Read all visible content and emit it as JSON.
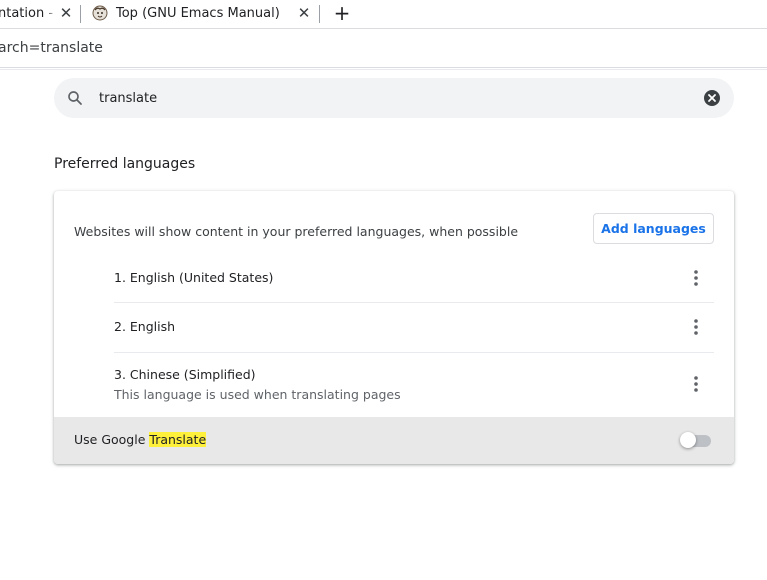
{
  "tabs": [
    {
      "title": "ntation - ",
      "active": false
    },
    {
      "title": "Top (GNU Emacs Manual)",
      "active": false
    }
  ],
  "new_tab_label": "+",
  "address_bar": {
    "url_text": "arch=translate"
  },
  "search": {
    "value": "translate"
  },
  "preferred_languages": {
    "title": "Preferred languages",
    "description": "Websites will show content in your preferred languages, when possible",
    "add_button_label": "Add languages",
    "languages": [
      {
        "name": "1. English (United States)"
      },
      {
        "name": "2. English"
      },
      {
        "name": "3. Chinese (Simplified)",
        "note": "This language is used when translating pages"
      }
    ]
  },
  "google_translate": {
    "label_prefix": "Use Google ",
    "label_highlight": "Translate",
    "enabled": false
  },
  "colors": {
    "accent": "#1a73e8",
    "highlight": "#fff03c",
    "search_bg": "#f1f3f4"
  },
  "icons": {
    "tab_close": "close-icon",
    "favicon": "gnu-emacs-icon",
    "search": "search-icon",
    "clear": "clear-search-icon",
    "more": "more-vert-icon"
  }
}
